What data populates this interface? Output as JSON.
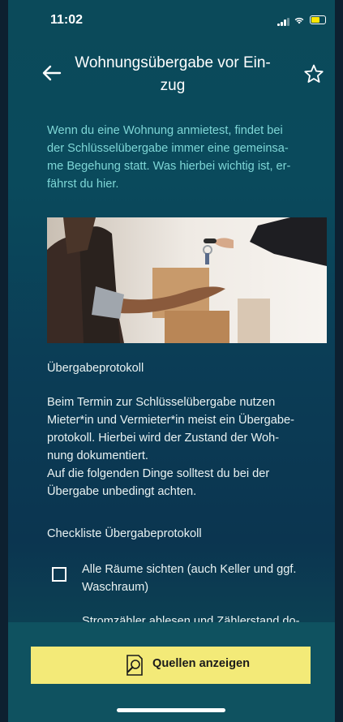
{
  "status_bar": {
    "time": "11:02"
  },
  "nav": {
    "title": "Wohnungsübergabe vor Ein-zug",
    "title_line1": "Wohnungsübergabe vor Ein-",
    "title_line2": "zug"
  },
  "article": {
    "intro_lines": [
      "Wenn du eine Wohnung anmietest, findet bei",
      "der Schlüsselübergabe immer eine gemeinsa-",
      "me Begehung statt. Was hierbei wichtig ist, er-",
      "fährst du hier."
    ],
    "section_title": "Übergabeprotokoll",
    "body_lines": [
      "Beim Termin zur Schlüsselübergabe nutzen",
      "Mieter*in und Vermieter*in meist ein Übergabe-",
      "protokoll. Hierbei wird der Zustand der Woh-",
      "nung dokumentiert.",
      "Auf die folgenden Dinge solltest du bei der",
      "Übergabe unbedingt achten."
    ],
    "checklist_title": "Checkliste Übergabeprotokoll",
    "checklist": [
      {
        "line1": "Alle Räume sichten (auch Keller und ggf.",
        "line2": "Waschraum)",
        "checked": false
      },
      {
        "line1": "Stromzähler ablesen und Zählerstand do-",
        "line2": "",
        "checked": false
      }
    ]
  },
  "footer": {
    "sources_button_label": "Quellen anzeigen"
  },
  "colors": {
    "accent_text": "#7ed6d6",
    "button_bg": "#f3ea78",
    "battery": "#ffe500"
  },
  "icons": {
    "back": "arrow-left-icon",
    "favorite": "star-outline-icon",
    "sources": "document-search-icon"
  }
}
